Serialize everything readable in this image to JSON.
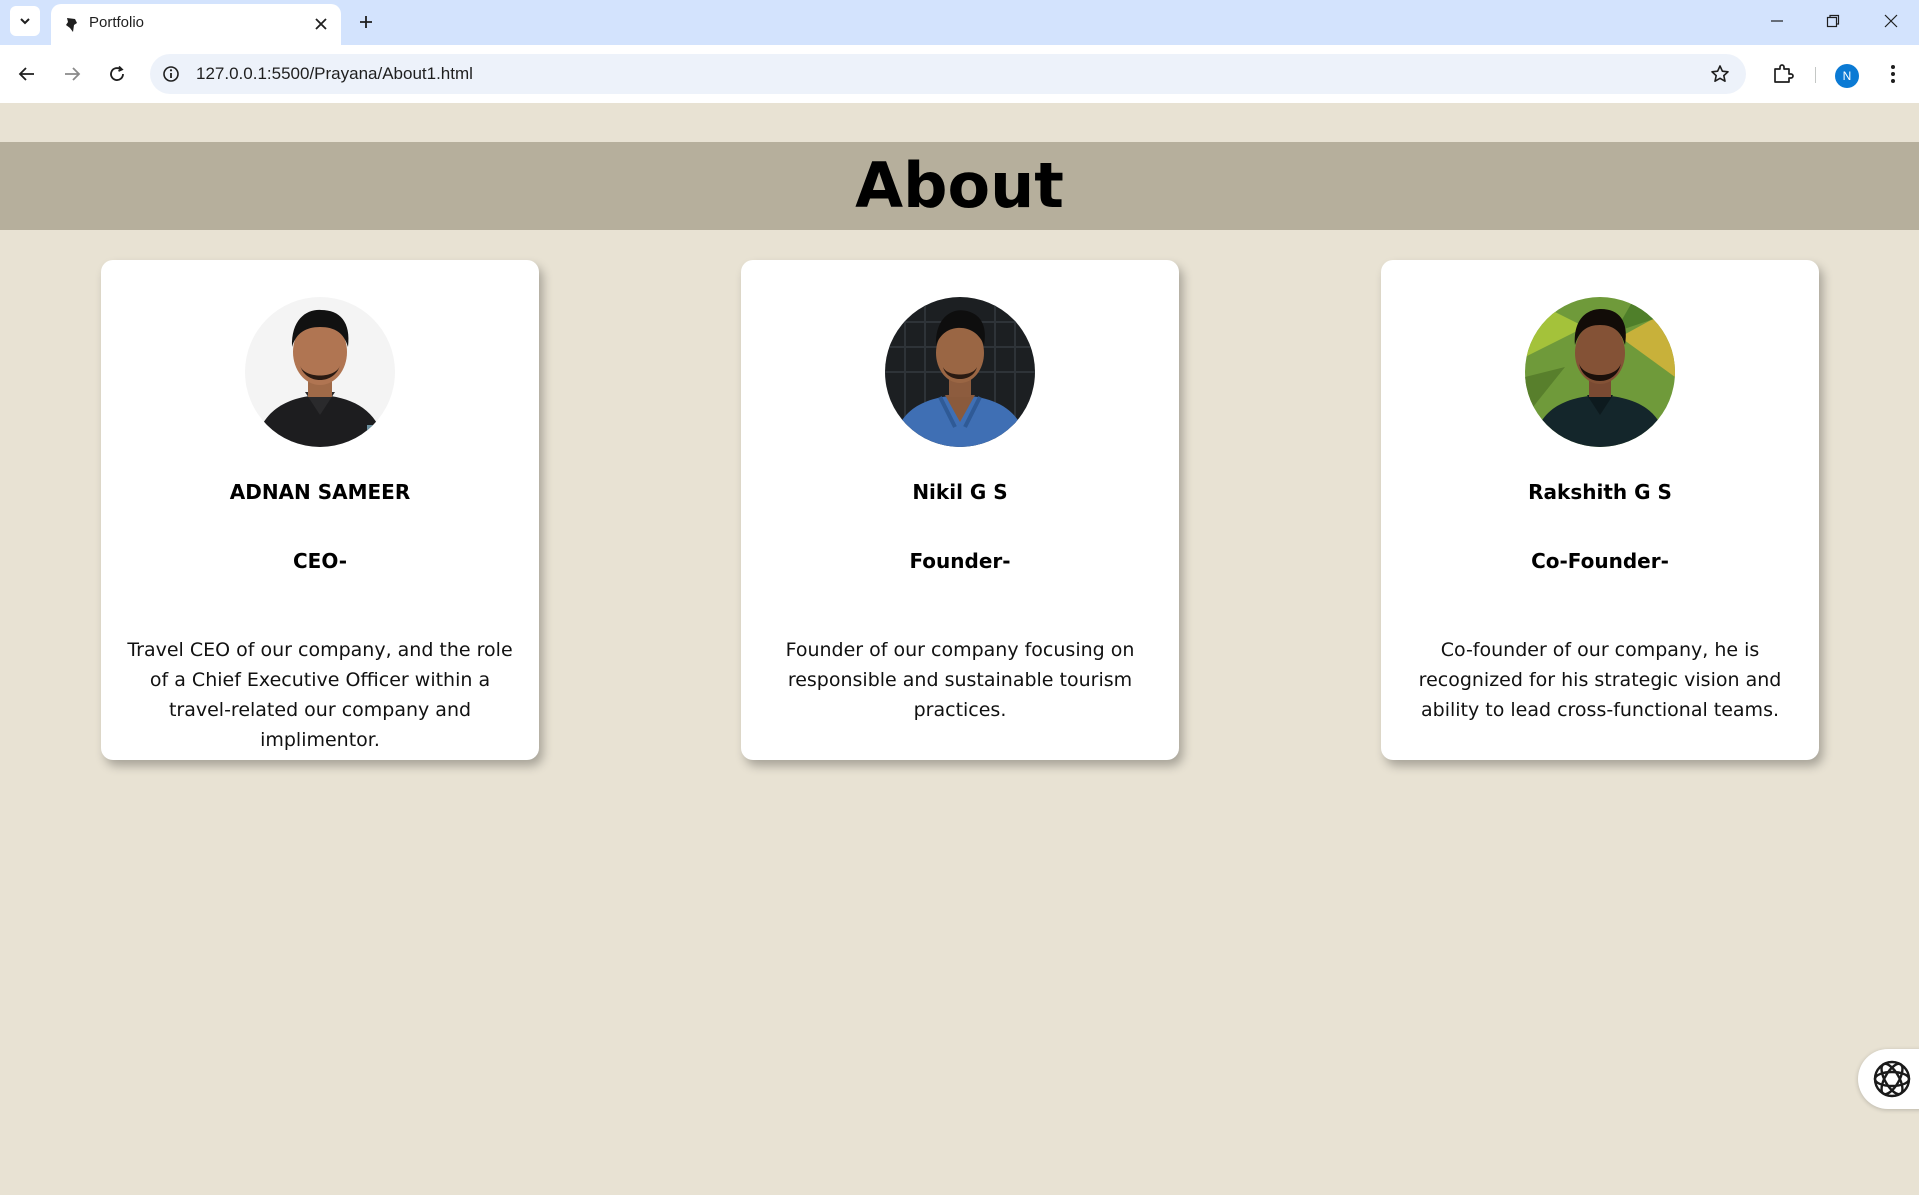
{
  "browser": {
    "tab_title": "Portfolio",
    "url": "127.0.0.1:5500/Prayana/About1.html",
    "profile_initial": "N",
    "icons": [
      "tab-list-icon",
      "favicon-icon",
      "close-tab-icon",
      "new-tab-icon",
      "minimize-icon",
      "restore-icon",
      "close-window-icon",
      "back-icon",
      "forward-icon",
      "reload-icon",
      "site-info-icon",
      "bookmark-star-icon",
      "extensions-icon",
      "more-menu-icon"
    ]
  },
  "page": {
    "title": "About",
    "colors": {
      "background": "#e8e2d3",
      "header_band": "#b6af9c",
      "card": "#ffffff"
    },
    "team": [
      {
        "name": "ADNAN SAMEER",
        "role": "CEO-",
        "description": "Travel CEO of our company, and the role of a Chief Executive Officer within a travel-related our company and implimentor."
      },
      {
        "name": "Nikil G S",
        "role": "Founder-",
        "description": "Founder of our company focusing on responsible and sustainable tourism practices."
      },
      {
        "name": "Rakshith G S",
        "role": "Co-Founder-",
        "description": "Co-founder of our company, he is recognized for his strategic vision and ability to lead cross-functional teams."
      }
    ]
  },
  "floating_widget": {
    "icon": "assistant-knot-icon"
  }
}
